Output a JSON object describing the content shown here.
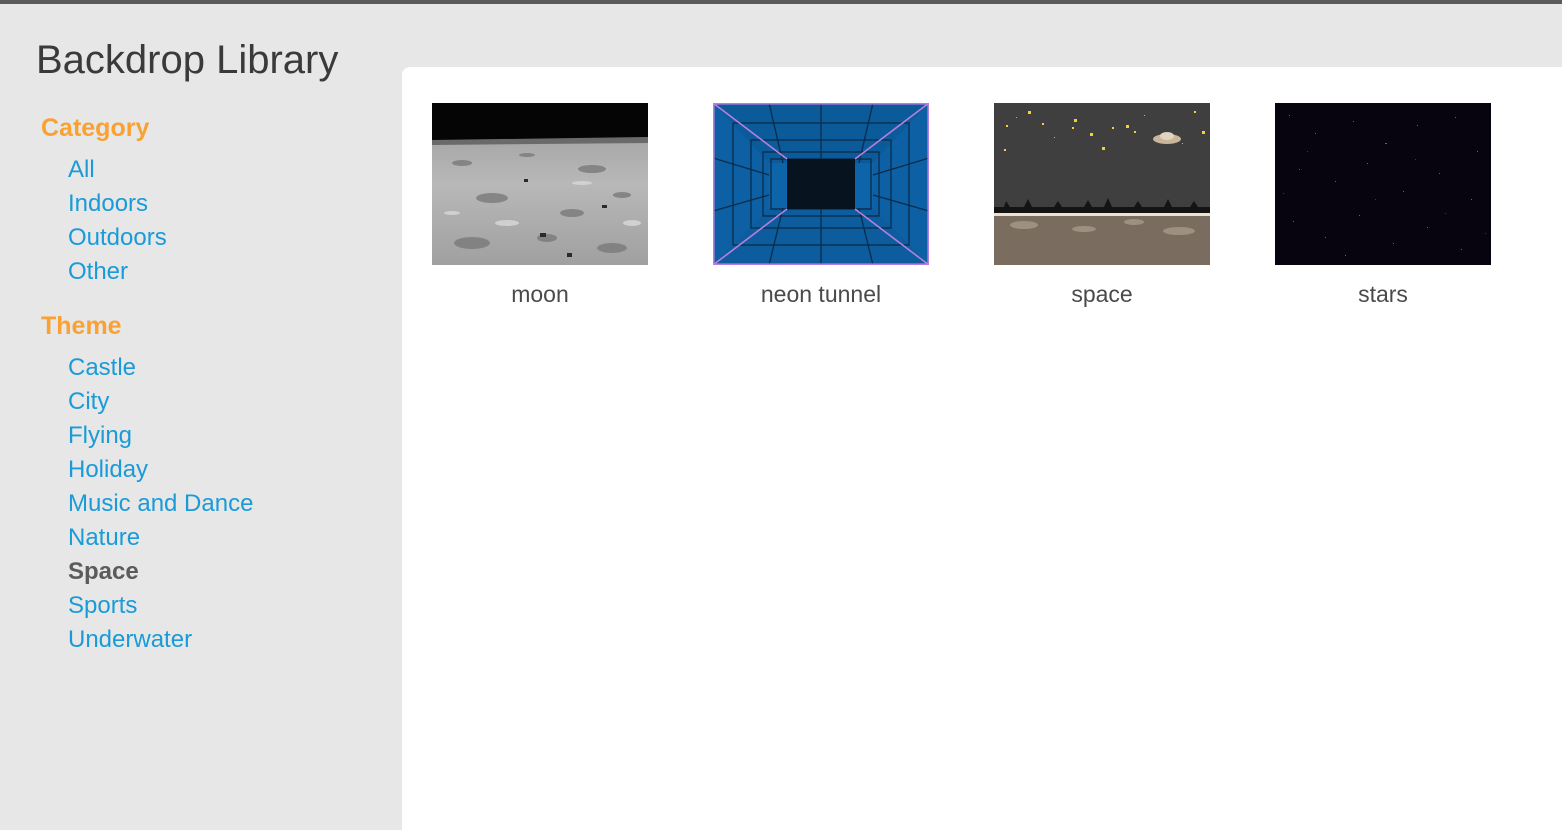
{
  "window": {
    "title": "Backdrop Library"
  },
  "sidebar": {
    "category_heading": "Category",
    "category_items": [
      {
        "label": "All"
      },
      {
        "label": "Indoors"
      },
      {
        "label": "Outdoors"
      },
      {
        "label": "Other"
      }
    ],
    "theme_heading": "Theme",
    "theme_items": [
      {
        "label": "Castle"
      },
      {
        "label": "City"
      },
      {
        "label": "Flying"
      },
      {
        "label": "Holiday"
      },
      {
        "label": "Music and Dance"
      },
      {
        "label": "Nature"
      },
      {
        "label": "Space",
        "selected": true
      },
      {
        "label": "Sports"
      },
      {
        "label": "Underwater"
      }
    ]
  },
  "backdrops": [
    {
      "name": "moon",
      "icon": "moon-surface-thumbnail"
    },
    {
      "name": "neon tunnel",
      "icon": "neon-tunnel-thumbnail"
    },
    {
      "name": "space",
      "icon": "space-scene-thumbnail"
    },
    {
      "name": "stars",
      "icon": "starfield-thumbnail"
    }
  ],
  "colors": {
    "accent_heading": "#f9a233",
    "link": "#1a9bd8",
    "selected": "#5a5b5a",
    "background": "#e6e7e6",
    "panel": "#ffffff"
  }
}
